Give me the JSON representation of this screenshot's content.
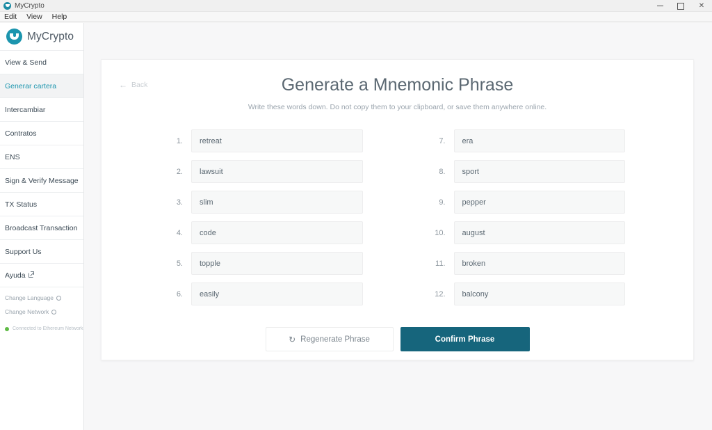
{
  "window": {
    "title": "MyCrypto",
    "app_icon": "mycrypto-logo-icon",
    "controls": {
      "minimize": "minimize-icon",
      "maximize": "maximize-icon",
      "close": "✕"
    }
  },
  "menubar": {
    "items": [
      {
        "label": "Edit"
      },
      {
        "label": "View"
      },
      {
        "label": "Help"
      }
    ]
  },
  "sidebar": {
    "brand": {
      "name": "MyCrypto",
      "logo": "mycrypto-logo-icon"
    },
    "items": [
      {
        "label": "View & Send",
        "active": false,
        "external": false
      },
      {
        "label": "Generar cartera",
        "active": true,
        "external": false
      },
      {
        "label": "Intercambiar",
        "active": false,
        "external": false
      },
      {
        "label": "Contratos",
        "active": false,
        "external": false
      },
      {
        "label": "ENS",
        "active": false,
        "external": false
      },
      {
        "label": "Sign & Verify Message",
        "active": false,
        "external": false
      },
      {
        "label": "TX Status",
        "active": false,
        "external": false
      },
      {
        "label": "Broadcast Transaction",
        "active": false,
        "external": false
      },
      {
        "label": "Support Us",
        "active": false,
        "external": false
      },
      {
        "label": "Ayuda",
        "active": false,
        "external": true
      }
    ],
    "footer": {
      "change_language": "Change Language",
      "change_network": "Change Network",
      "status": "Connected to Ethereum Network"
    }
  },
  "main": {
    "back_label": "Back",
    "back_icon": "arrow-left-icon",
    "title": "Generate a Mnemonic Phrase",
    "subtitle": "Write these words down. Do not copy them to your clipboard, or save them anywhere online.",
    "words": [
      {
        "num": "1.",
        "word": "retreat"
      },
      {
        "num": "7.",
        "word": "era"
      },
      {
        "num": "2.",
        "word": "lawsuit"
      },
      {
        "num": "8.",
        "word": "sport"
      },
      {
        "num": "3.",
        "word": "slim"
      },
      {
        "num": "9.",
        "word": "pepper"
      },
      {
        "num": "4.",
        "word": "code"
      },
      {
        "num": "10.",
        "word": "august"
      },
      {
        "num": "5.",
        "word": "topple"
      },
      {
        "num": "11.",
        "word": "broken"
      },
      {
        "num": "6.",
        "word": "easily"
      },
      {
        "num": "12.",
        "word": "balcony"
      }
    ],
    "buttons": {
      "regenerate": "Regenerate Phrase",
      "regenerate_icon": "↻",
      "confirm": "Confirm Phrase"
    }
  },
  "colors": {
    "accent": "#1c95ae",
    "confirm_button": "#16657c",
    "status_green": "#5fbb46",
    "page_bg": "#f7f7f8",
    "card_bg": "#ffffff"
  }
}
